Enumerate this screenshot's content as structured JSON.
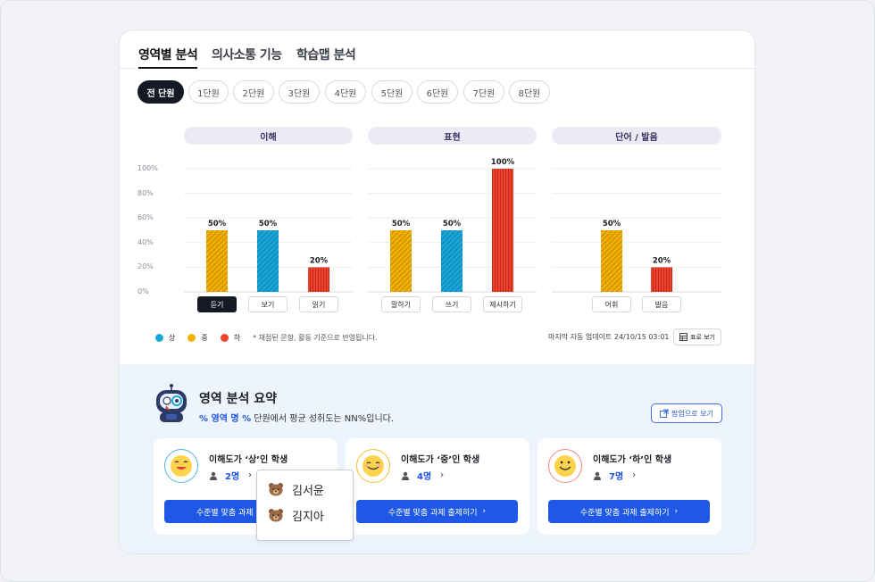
{
  "tabs": [
    {
      "label": "영역별 분석",
      "active": true
    },
    {
      "label": "의사소통 기능",
      "active": false
    },
    {
      "label": "학습맵 분석",
      "active": false
    }
  ],
  "units": [
    {
      "label": "전 단원",
      "active": true
    },
    {
      "label": "1단원"
    },
    {
      "label": "2단원"
    },
    {
      "label": "3단원"
    },
    {
      "label": "4단원"
    },
    {
      "label": "5단원"
    },
    {
      "label": "6단원"
    },
    {
      "label": "7단원"
    },
    {
      "label": "8단원"
    }
  ],
  "chart_data": {
    "type": "bar",
    "y_ticks": [
      "100%",
      "80%",
      "60%",
      "40%",
      "20%",
      "0%"
    ],
    "ylim": [
      0,
      100
    ],
    "value_suffix": "%",
    "level_colors": {
      "상": "#1aa7d8",
      "중": "#f0b400",
      "하": "#ef4330"
    },
    "groups": [
      {
        "title": "이해",
        "bars": [
          {
            "label": "듣기",
            "value": 50,
            "level": "중",
            "selected": true
          },
          {
            "label": "보기",
            "value": 50,
            "level": "상"
          },
          {
            "label": "읽기",
            "value": 20,
            "level": "하"
          }
        ]
      },
      {
        "title": "표현",
        "bars": [
          {
            "label": "말하기",
            "value": 50,
            "level": "중"
          },
          {
            "label": "쓰기",
            "value": 50,
            "level": "상"
          },
          {
            "label": "제시하기",
            "value": 100,
            "level": "하"
          }
        ]
      },
      {
        "title": "단어 / 발음",
        "bars": [
          {
            "label": "어휘",
            "value": 50,
            "level": "중"
          },
          {
            "label": "발음",
            "value": 20,
            "level": "하"
          }
        ]
      }
    ]
  },
  "legend": [
    {
      "label": "상",
      "color": "#1aa7d8"
    },
    {
      "label": "중",
      "color": "#f0b400"
    },
    {
      "label": "하",
      "color": "#ef4330"
    }
  ],
  "legend_note": "* 채점된 문항, 활동 기준으로 반영됩니다.",
  "updated_text": "마지막 자동 업데이트 24/10/15 03:01",
  "table_button": "표로 보기",
  "summary": {
    "title": "영역 분석 요약",
    "highlight": "% 영역 명 %",
    "subtitle_rest": " 단원에서 평균 성취도는 NN%입니다.",
    "popup_button": "팝업으로 보기",
    "cards": [
      {
        "title": "이해도가 ‘상’인 학생",
        "count": "2명",
        "button": "수준별 맞춤 과제 출제하기",
        "border": "#4fb8e0"
      },
      {
        "title": "이해도가 ‘중’인 학생",
        "count": "4명",
        "button": "수준별 맞춤 과제 출제하기",
        "border": "#f0c030"
      },
      {
        "title": "이해도가 ‘하’인 학생",
        "count": "7명",
        "button": "수준별 맞춤 과제 출제하기",
        "border": "#f08a80"
      }
    ],
    "dropdown_students": [
      "김서윤",
      "김지아"
    ]
  }
}
